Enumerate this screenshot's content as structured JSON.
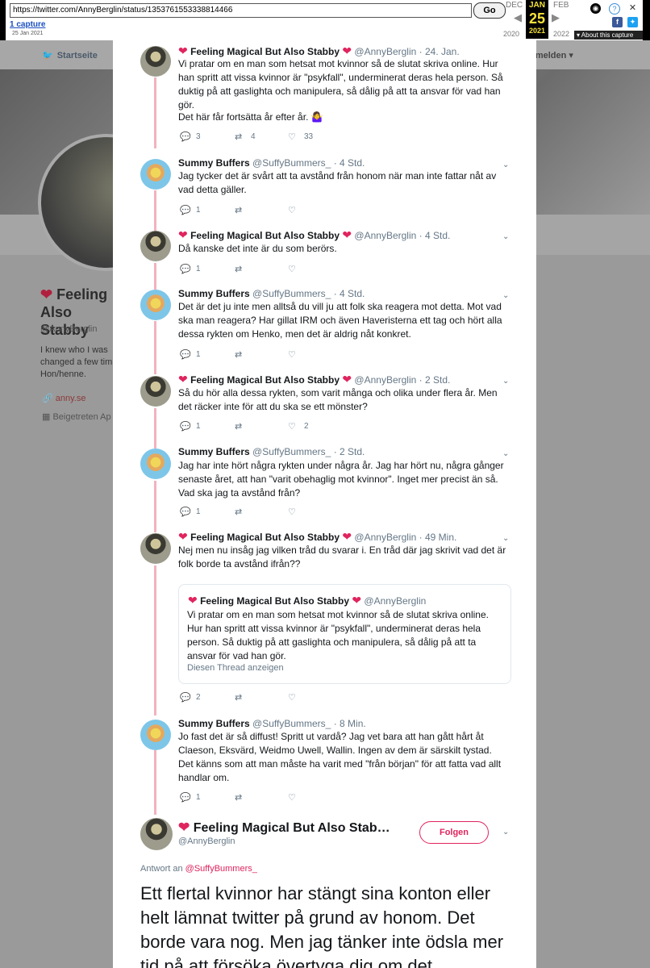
{
  "wayback": {
    "url": "https://twitter.com/AnnyBerglin/status/1353761553338814466",
    "go_label": "Go",
    "captures_label": "1 capture",
    "capture_date": "25 Jan 2021",
    "prev_month": "DEC",
    "cur_month": "JAN",
    "cur_day": "25",
    "cur_year": "2021",
    "next_month": "FEB",
    "prev_year": "2020",
    "next_year": "2022",
    "about_label": "About this capture"
  },
  "background": {
    "nav_home": "Startseite",
    "nav_login": "Anmelden",
    "profile_name": "Feeling Also Stabby",
    "profile_handle": "@AnnyBerglin",
    "bio": "I knew who I was changed a few tim Hon/henne.",
    "link": "anny.se",
    "joined": "Beigetreten Ap"
  },
  "tweets": [
    {
      "name": "Feeling Magical But Also Stabby",
      "handle": "@AnnyBerglin · 24. Jan.",
      "text": "Vi pratar om en man som hetsat mot kvinnor så de slutat skriva online. Hur han spritt att vissa kvinnor är \"psykfall\", underminerat deras hela person. Så duktig på att gaslighta och manipulera, så dålig på att ta ansvar för vad han gör.",
      "text2": "Det här får fortsätta år efter år. 🤷‍♀️",
      "replies": "3",
      "retweets": "4",
      "likes": "33"
    },
    {
      "name": "Summy Buffers",
      "handle": "@SuffyBummers_ · 4 Std.",
      "text": "Jag tycker det är svårt att ta avstånd från honom när man inte fattar nåt av vad detta gäller.",
      "replies": "1",
      "retweets": "",
      "likes": ""
    },
    {
      "name": "Feeling Magical But Also Stabby",
      "handle": "@AnnyBerglin · 4 Std.",
      "text": "Då kanske det inte är du som berörs.",
      "replies": "1",
      "retweets": "",
      "likes": ""
    },
    {
      "name": "Summy Buffers",
      "handle": "@SuffyBummers_ · 4 Std.",
      "text": "Det är det ju inte men alltså du vill ju att folk ska reagera mot detta. Mot vad ska man reagera? Har gillat IRM och även Haveristerna ett tag och hört alla dessa rykten om Henko, men det är aldrig nåt konkret.",
      "replies": "1",
      "retweets": "",
      "likes": ""
    },
    {
      "name": "Feeling Magical But Also Stabby",
      "handle": "@AnnyBerglin · 2 Std.",
      "text": "Så du hör alla dessa rykten, som varit många och olika under flera år. Men det räcker inte för att du ska se ett mönster?",
      "replies": "1",
      "retweets": "",
      "likes": "2"
    },
    {
      "name": "Summy Buffers",
      "handle": "@SuffyBummers_ · 2 Std.",
      "text": "Jag har inte hört några rykten under några år. Jag har hört nu, några gånger senaste året, att han \"varit obehaglig mot kvinnor\". Inget mer precist än så. Vad ska jag ta avstånd från?",
      "replies": "1",
      "retweets": "",
      "likes": ""
    },
    {
      "name": "Feeling Magical But Also Stabby",
      "handle": "@AnnyBerglin · 49 Min.",
      "text": "Nej men nu insåg jag vilken tråd du svarar i. En tråd där jag skrivit vad det är folk borde ta avstånd ifrån??",
      "replies": "2",
      "retweets": "",
      "likes": ""
    },
    {
      "name": "Summy Buffers",
      "handle": "@SuffyBummers_ · 8 Min.",
      "text": "Jo fast det är så diffust! Spritt ut vardå? Jag vet bara att han gått hårt åt Claeson, Eksvärd, Weidmo Uwell, Wallin. Ingen av dem är särskilt tystad. Det känns som att man måste ha varit med \"från början\" för att fatta vad allt handlar om.",
      "replies": "1",
      "retweets": "",
      "likes": ""
    }
  ],
  "quote": {
    "name": "Feeling Magical But Also Stabby",
    "handle": "@AnnyBerglin",
    "text": "Vi pratar om en man som hetsat mot kvinnor så de slutat skriva online. Hur han spritt att vissa kvinnor är \"psykfall\", underminerat deras hela person. Så duktig på att gaslighta och manipulera, så dålig på att ta ansvar för vad han gör.",
    "link": "Diesen Thread anzeigen"
  },
  "main": {
    "name": "Feeling Magical But Also Stab…",
    "handle": "@AnnyBerglin",
    "follow_label": "Folgen",
    "reply_prefix": "Antwort an",
    "reply_user": "@SuffyBummers_",
    "text": "Ett flertal kvinnor har stängt sina konton eller helt lämnat twitter på grund av honom. Det borde vara nog. Men jag tänker inte ödsla mer tid på att försöka övertyga dig om det."
  },
  "colors": {
    "accent": "#e0245e",
    "thread_line": "#f2b3be",
    "muted": "#657786"
  }
}
